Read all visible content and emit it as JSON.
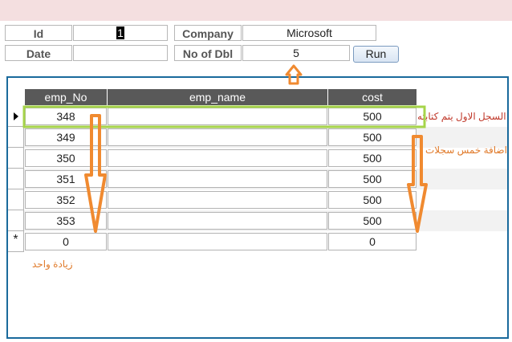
{
  "form": {
    "id_label": "Id",
    "id_value": "1",
    "company_label": "Company",
    "company_value": "Microsoft",
    "date_label": "Date",
    "date_value": "",
    "no_dbl_label": "No of Dbl",
    "no_dbl_value": "5",
    "run_label": "Run"
  },
  "grid": {
    "columns": [
      "emp_No",
      "emp_name",
      "cost"
    ],
    "rows": [
      {
        "emp_no": "348",
        "emp_name": "",
        "cost": "500"
      },
      {
        "emp_no": "349",
        "emp_name": "",
        "cost": "500"
      },
      {
        "emp_no": "350",
        "emp_name": "",
        "cost": "500"
      },
      {
        "emp_no": "351",
        "emp_name": "",
        "cost": "500"
      },
      {
        "emp_no": "352",
        "emp_name": "",
        "cost": "500"
      },
      {
        "emp_no": "353",
        "emp_name": "",
        "cost": "500"
      }
    ],
    "new_row": {
      "marker": "*",
      "emp_no": "0",
      "emp_name": "",
      "cost": "0"
    },
    "current_row_icon": "triangle-right-icon"
  },
  "annotations": {
    "first_record": "السجل الاول يتم كتابته",
    "add_five": "اضافة خمس سجلات",
    "increment_one": "زيادة واحد"
  },
  "colors": {
    "top_bar": "#f4dfe0",
    "frame_border": "#1a6a9c",
    "header_bg": "#595959",
    "highlight_border": "#a6d44a",
    "arrow_orange": "#f08a30",
    "note_red": "#c0392b",
    "note_orange": "#e07a2a"
  }
}
